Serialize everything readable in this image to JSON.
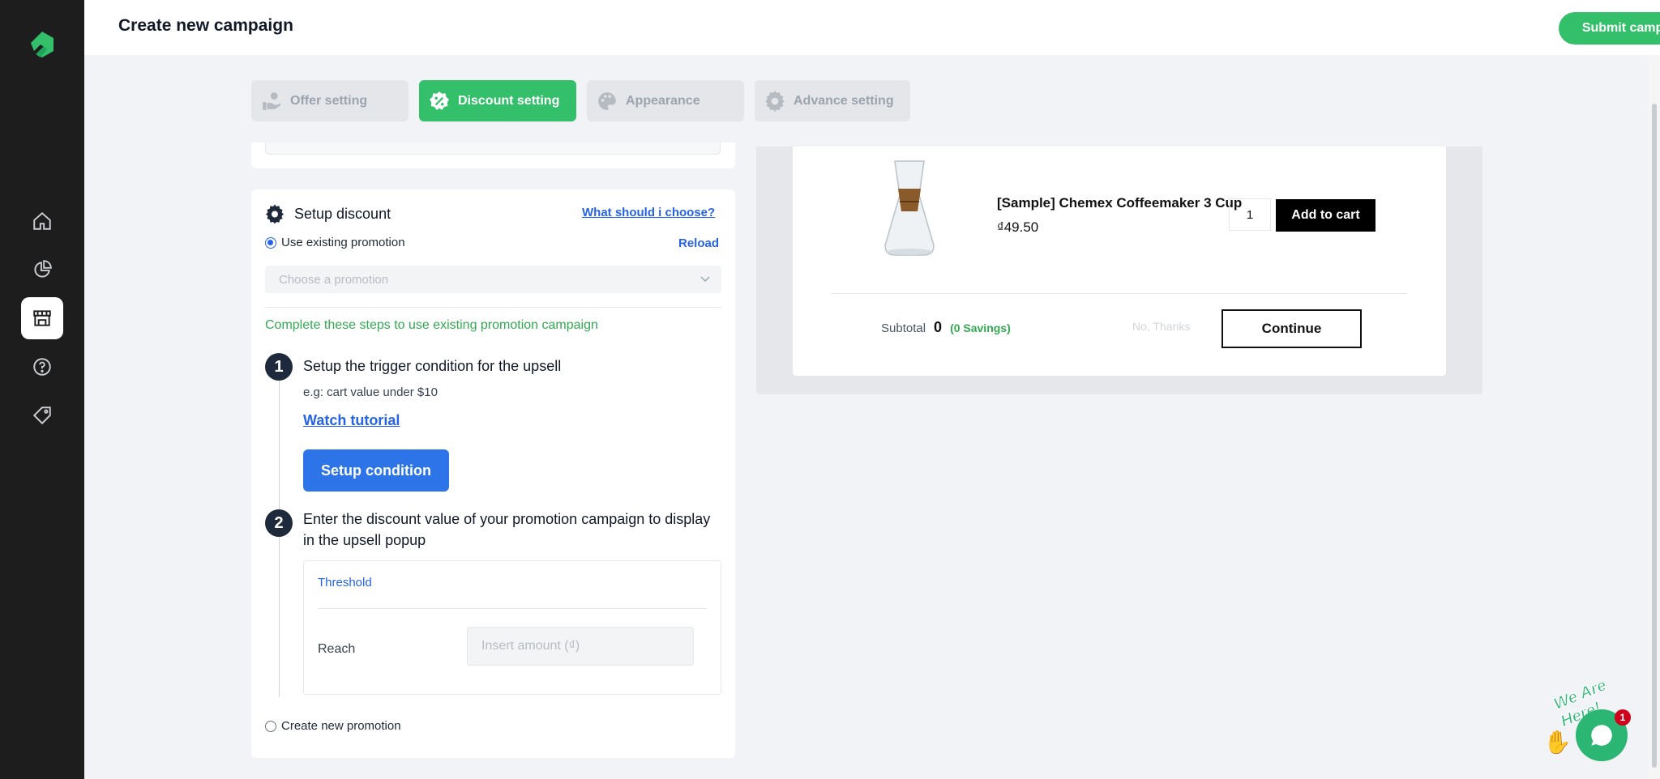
{
  "header": {
    "title": "Create new campaign",
    "submit_label": "Submit campaign"
  },
  "sidebar": {
    "items": [
      {
        "icon": "home-icon"
      },
      {
        "icon": "analytics-icon"
      },
      {
        "icon": "store-icon",
        "active": true
      },
      {
        "icon": "help-icon"
      },
      {
        "icon": "tag-icon"
      }
    ]
  },
  "tabs": [
    {
      "label": "Offer setting",
      "icon": "hand-coin-icon",
      "active": false
    },
    {
      "label": "Discount setting",
      "icon": "discount-badge-icon",
      "active": true
    },
    {
      "label": "Appearance",
      "icon": "palette-icon",
      "active": false
    },
    {
      "label": "Advance setting",
      "icon": "gear-icon",
      "active": false
    }
  ],
  "setup": {
    "title": "Setup discount",
    "help_link": "What should i choose?",
    "use_existing_label": "Use existing promotion",
    "reload_label": "Reload",
    "select_placeholder": "Choose a promotion",
    "steps_note": "Complete these steps to use existing promotion campaign",
    "step1": {
      "number": "1",
      "title": "Setup the trigger condition for the upsell",
      "example": "e.g: cart value under $10",
      "tutorial_link": "Watch tutorial",
      "button_label": "Setup condition"
    },
    "step2": {
      "number": "2",
      "title": "Enter the discount value of your promotion campaign to display in the upsell popup",
      "threshold_label": "Threshold",
      "reach_label": "Reach",
      "amount_placeholder": "Insert amount (₫)"
    },
    "create_new_label": "Create new promotion"
  },
  "preview": {
    "product_name": "[Sample] Chemex Coffeemaker 3 Cup",
    "price": "₫49.50",
    "quantity": "1",
    "add_to_cart_label": "Add to cart",
    "subtotal_label": "Subtotal",
    "subtotal_value": "0",
    "savings_text": "(0 Savings)",
    "no_thanks_label": "No, Thanks",
    "continue_label": "Continue"
  },
  "chat": {
    "badge_count": "1",
    "tagline": "We Are Here!"
  },
  "colors": {
    "brand_green": "#34c06b",
    "primary_blue": "#2c74e8",
    "sidebar_bg": "#1d1d1d"
  }
}
